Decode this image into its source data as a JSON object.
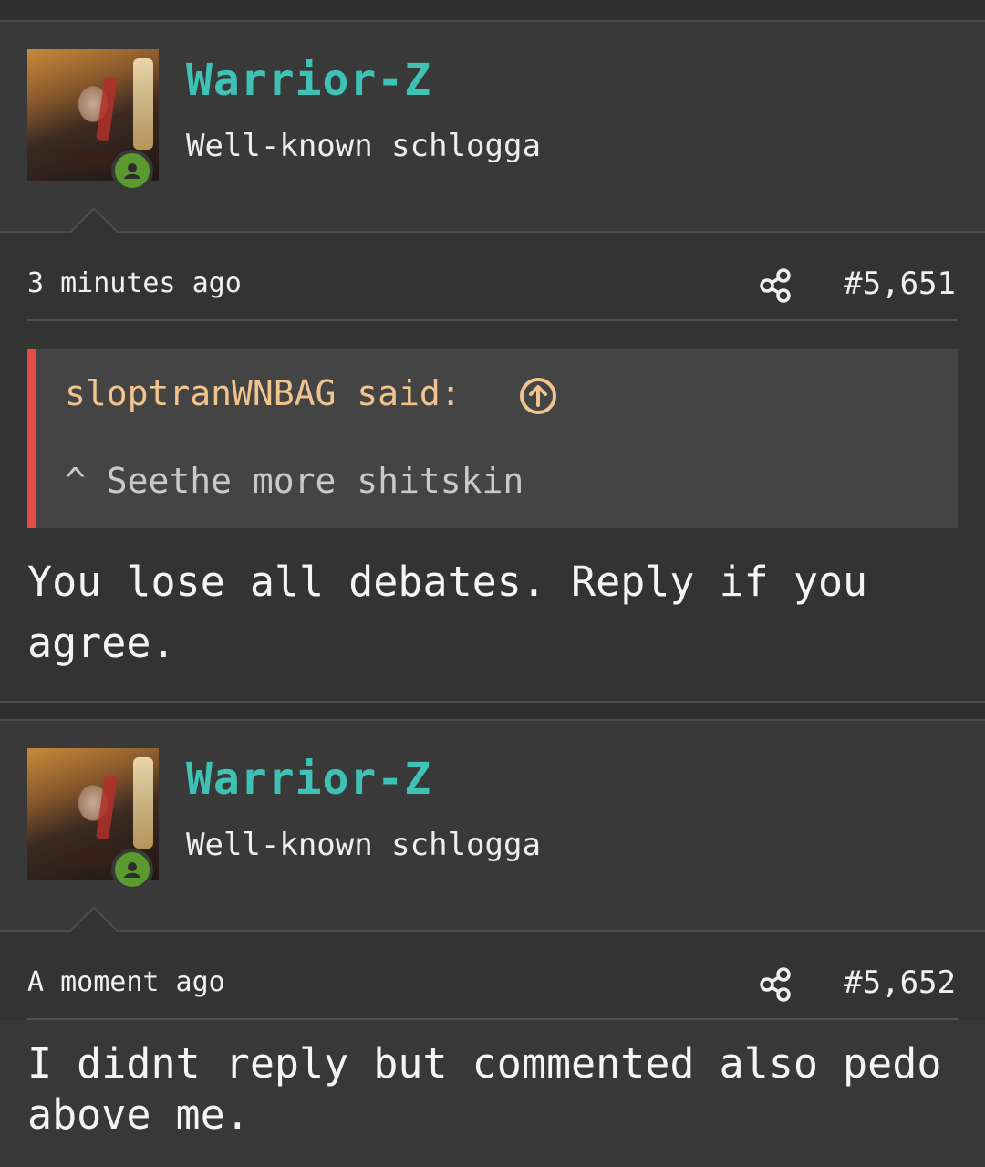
{
  "posts": [
    {
      "username": "Warrior-Z",
      "user_title": "Well-known schlogga",
      "time": "3 minutes ago",
      "post_number": "#5,651",
      "quote": {
        "author_line": "sloptranWNBAG said:",
        "text": "^ Seethe more shitskin"
      },
      "message": "You lose all debates. Reply if you agree."
    },
    {
      "username": "Warrior-Z",
      "user_title": "Well-known schlogga",
      "time": "A moment ago",
      "post_number": "#5,652",
      "message": "I didnt reply but commented also pedo above me."
    }
  ],
  "icons": {
    "share": "share-icon",
    "quote_jump": "arrow-up-circle-icon",
    "online": "user-presence-icon"
  },
  "colors": {
    "username": "#3fc1b5",
    "quote_accent": "#e44b47",
    "quote_author": "#f0c48e",
    "presence": "#5a9a2e"
  }
}
